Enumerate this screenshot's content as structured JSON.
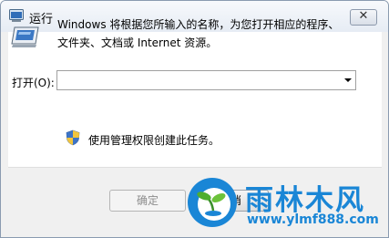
{
  "window": {
    "title": "运行",
    "close_glyph": "✕"
  },
  "description": {
    "line1": "Windows 将根据您所输入的名称，为您打开相应的程序、",
    "line2": "文件夹、文档或 Internet 资源。"
  },
  "open_field": {
    "label": "打开(O):",
    "value": ""
  },
  "admin_note": "使用管理权限创建此任务。",
  "buttons": {
    "ok": "确定",
    "cancel": "取消"
  },
  "watermark": {
    "name": "雨林木风",
    "url": "www.ylmf888.com"
  },
  "colors": {
    "watermark_blue": "#1a86d6",
    "titlebar": "#e6ecf4"
  },
  "icons": [
    "run-app-icon",
    "run-program-icon",
    "uac-shield-icon",
    "dropdown-arrow-icon",
    "close-icon"
  ]
}
